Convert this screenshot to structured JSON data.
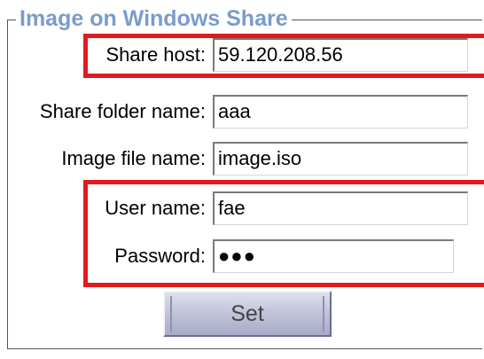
{
  "panel": {
    "legend": "Image on Windows Share"
  },
  "form": {
    "share_host": {
      "label": "Share host:",
      "value": "59.120.208.56"
    },
    "share_folder_name": {
      "label": "Share folder name:",
      "value": "aaa"
    },
    "image_file_name": {
      "label": "Image file name:",
      "value": "image.iso"
    },
    "user_name": {
      "label": "User name:",
      "value": "fae"
    },
    "password": {
      "label": "Password:",
      "masked_value": "●●●"
    },
    "set_button_label": "Set"
  },
  "colors": {
    "legend": "#7a9ccb",
    "highlight_box": "#e2191d",
    "button_top": "#dfe0ee",
    "button_bottom": "#a9abc8"
  }
}
